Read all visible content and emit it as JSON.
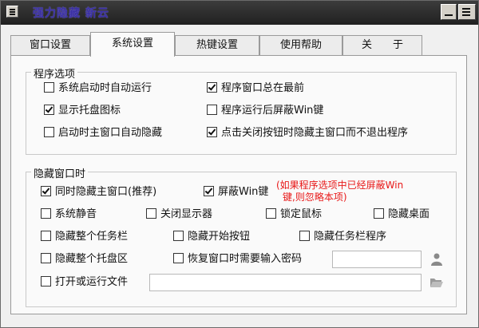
{
  "window": {
    "title": "强力隐藏 新云"
  },
  "tabs": [
    {
      "label": "窗口设置",
      "active": false
    },
    {
      "label": "系统设置",
      "active": true
    },
    {
      "label": "热键设置",
      "active": false
    },
    {
      "label": "使用帮助",
      "active": false
    },
    {
      "label": "关　　于",
      "active": false
    }
  ],
  "program_options": {
    "title": "程序选项",
    "items": [
      {
        "label": "系统启动时自动运行",
        "checked": false
      },
      {
        "label": "程序窗口总在最前",
        "checked": true
      },
      {
        "label": "显示托盘图标",
        "checked": true
      },
      {
        "label": "程序运行后屏蔽Win键",
        "checked": false
      },
      {
        "label": "启动时主窗口自动隐藏",
        "checked": false
      },
      {
        "label": "点击关闭按钮时隐藏主窗口而不退出程序",
        "checked": true
      }
    ]
  },
  "hide_window": {
    "title": "隐藏窗口时",
    "items": [
      {
        "label": "同时隐藏主窗口(推荐)",
        "checked": true
      },
      {
        "label": "屏蔽Win键",
        "checked": true
      },
      {
        "label": "系统静音",
        "checked": false
      },
      {
        "label": "关闭显示器",
        "checked": false
      },
      {
        "label": "锁定鼠标",
        "checked": false
      },
      {
        "label": "隐藏桌面",
        "checked": false
      },
      {
        "label": "隐藏整个任务栏",
        "checked": false
      },
      {
        "label": "隐藏开始按钮",
        "checked": false
      },
      {
        "label": "隐藏任务栏程序",
        "checked": false
      },
      {
        "label": "隐藏整个托盘区",
        "checked": false
      },
      {
        "label": "恢复窗口时需要输入密码",
        "checked": false
      },
      {
        "label": "打开或运行文件",
        "checked": false
      }
    ],
    "win_key_note_line1": "(如果程序选项中已经屏蔽Win",
    "win_key_note_line2": "键,则忽略本项)",
    "password_value": "",
    "file_path_value": ""
  },
  "icons": {
    "user": "user-icon",
    "folder": "folder-open-icon"
  },
  "colors": {
    "title_text": "#3a2fa3",
    "note_text": "#e81818",
    "titlebar_bg": "#2a2a2a"
  }
}
